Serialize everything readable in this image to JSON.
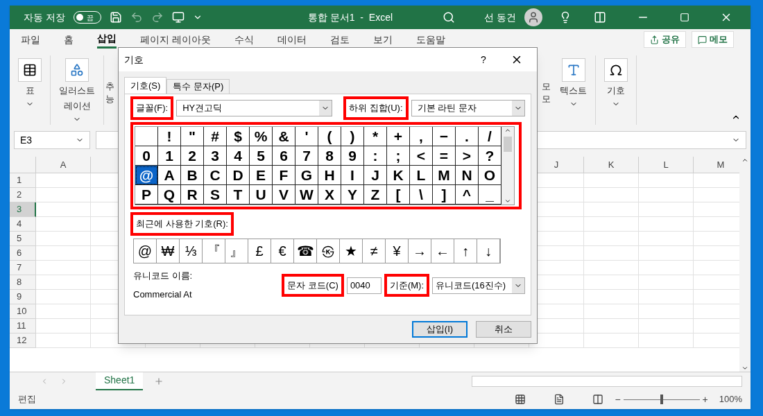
{
  "title_bar": {
    "autosave_label": "자동 저장",
    "autosave": {
      "on": false,
      "text": "끔"
    },
    "title": "통합 문서1  -  Excel",
    "user": "선 동건"
  },
  "ribbon_tabs": [
    {
      "label": "파일",
      "selected": false
    },
    {
      "label": "홈",
      "selected": false
    },
    {
      "label": "삽입",
      "selected": true
    },
    {
      "label": "페이지 레이아웃",
      "selected": false
    },
    {
      "label": "수식",
      "selected": false
    },
    {
      "label": "데이터",
      "selected": false
    },
    {
      "label": "검토",
      "selected": false
    },
    {
      "label": "보기",
      "selected": false
    },
    {
      "label": "도움말",
      "selected": false
    }
  ],
  "ribbon_actions": [
    {
      "kind": "share",
      "label": "공유"
    },
    {
      "kind": "comment",
      "label": "메모"
    }
  ],
  "ribbon_groups_left": [
    {
      "kind": "table",
      "lines": [
        "표"
      ]
    },
    {
      "kind": "shapes",
      "lines": [
        "일러스트",
        "레이션"
      ]
    },
    {
      "kind": "partial",
      "lines": [
        "추",
        "능"
      ]
    }
  ],
  "ribbon_groups_right": [
    {
      "kind": "partial",
      "lines": [
        "모",
        "모"
      ]
    },
    {
      "kind": "text",
      "lines": [
        "텍스트"
      ]
    },
    {
      "kind": "symbol",
      "lines": [
        "기호"
      ]
    }
  ],
  "name_box": "E3",
  "columns": [
    "A",
    "J",
    "K",
    "L",
    "M"
  ],
  "rows": [
    {
      "label": "1",
      "selected": false
    },
    {
      "label": "2",
      "selected": false
    },
    {
      "label": "3",
      "selected": true
    },
    {
      "label": "4",
      "selected": false
    },
    {
      "label": "5",
      "selected": false
    },
    {
      "label": "6",
      "selected": false
    },
    {
      "label": "7",
      "selected": false
    },
    {
      "label": "8",
      "selected": false
    },
    {
      "label": "9",
      "selected": false
    },
    {
      "label": "10",
      "selected": false
    },
    {
      "label": "11",
      "selected": false
    },
    {
      "label": "12",
      "selected": false
    }
  ],
  "sheet_tabs": [
    {
      "label": "Sheet1",
      "selected": true
    }
  ],
  "status_bar": {
    "mode": "편집",
    "zoom": {
      "minus": "−",
      "plus": "+",
      "level": 0.5,
      "reading": "100%"
    }
  },
  "dialog": {
    "title": "기호",
    "help": "?",
    "tabs": [
      {
        "label": "기호(S)",
        "selected": true
      },
      {
        "label": "특수 문자(P)",
        "selected": false
      }
    ],
    "font": {
      "label": "글꼴(F):",
      "highlighted": true,
      "value": "HY견고딕"
    },
    "subset": {
      "label": "하위 집합(U):",
      "highlighted": true,
      "value": "기본 라틴 문자"
    },
    "grid_highlighted": true,
    "grid": [
      [
        {
          "selected": false
        },
        {
          "c": "!",
          "selected": false
        },
        {
          "c": "\"",
          "selected": false
        },
        {
          "c": "#",
          "selected": false
        },
        {
          "c": "$",
          "selected": false
        },
        {
          "c": "%",
          "selected": false
        },
        {
          "c": "&",
          "selected": false
        },
        {
          "c": "'",
          "selected": false
        },
        {
          "c": "(",
          "selected": false
        },
        {
          "c": ")",
          "selected": false
        },
        {
          "c": "*",
          "selected": false
        },
        {
          "c": "+",
          "selected": false
        },
        {
          "c": ",",
          "selected": false
        },
        {
          "c": "−",
          "selected": false
        },
        {
          "c": ".",
          "selected": false
        },
        {
          "c": "/",
          "selected": false
        }
      ],
      [
        {
          "c": "0",
          "selected": false
        },
        {
          "c": "1",
          "selected": false
        },
        {
          "c": "2",
          "selected": false
        },
        {
          "c": "3",
          "selected": false
        },
        {
          "c": "4",
          "selected": false
        },
        {
          "c": "5",
          "selected": false
        },
        {
          "c": "6",
          "selected": false
        },
        {
          "c": "7",
          "selected": false
        },
        {
          "c": "8",
          "selected": false
        },
        {
          "c": "9",
          "selected": false
        },
        {
          "c": ":",
          "selected": false
        },
        {
          "c": ";",
          "selected": false
        },
        {
          "c": "<",
          "selected": false
        },
        {
          "c": "=",
          "selected": false
        },
        {
          "c": ">",
          "selected": false
        },
        {
          "c": "?",
          "selected": false
        }
      ],
      [
        {
          "c": "@",
          "selected": true
        },
        {
          "c": "A",
          "selected": false
        },
        {
          "c": "B",
          "selected": false
        },
        {
          "c": "C",
          "selected": false
        },
        {
          "c": "D",
          "selected": false
        },
        {
          "c": "E",
          "selected": false
        },
        {
          "c": "F",
          "selected": false
        },
        {
          "c": "G",
          "selected": false
        },
        {
          "c": "H",
          "selected": false
        },
        {
          "c": "I",
          "selected": false
        },
        {
          "c": "J",
          "selected": false
        },
        {
          "c": "K",
          "selected": false
        },
        {
          "c": "L",
          "selected": false
        },
        {
          "c": "M",
          "selected": false
        },
        {
          "c": "N",
          "selected": false
        },
        {
          "c": "O",
          "selected": false
        }
      ],
      [
        {
          "c": "P",
          "selected": false
        },
        {
          "c": "Q",
          "selected": false
        },
        {
          "c": "R",
          "selected": false
        },
        {
          "c": "S",
          "selected": false
        },
        {
          "c": "T",
          "selected": false
        },
        {
          "c": "U",
          "selected": false
        },
        {
          "c": "V",
          "selected": false
        },
        {
          "c": "W",
          "selected": false
        },
        {
          "c": "X",
          "selected": false
        },
        {
          "c": "Y",
          "selected": false
        },
        {
          "c": "Z",
          "selected": false
        },
        {
          "c": "[",
          "selected": false
        },
        {
          "c": "\\",
          "selected": false
        },
        {
          "c": "]",
          "selected": false
        },
        {
          "c": "^",
          "selected": false
        },
        {
          "c": "_",
          "selected": false
        }
      ]
    ],
    "recent": {
      "label": "최근에 사용한 기호(R):",
      "highlighted": true,
      "symbols": [
        "@",
        "₩",
        "⅓",
        "『",
        "』",
        "£",
        "€",
        "☎",
        "㉿",
        "★",
        "≠",
        "¥",
        "→",
        "←",
        "↑",
        "↓"
      ]
    },
    "unicode_name": {
      "label": "유니코드 이름:",
      "value": "Commercial At"
    },
    "char_code": {
      "label": "문자 코드(C)",
      "highlighted": true,
      "value": "0040"
    },
    "base": {
      "label": "기준(M):",
      "highlighted": true,
      "value": "유니코드(16진수)"
    },
    "buttons": [
      {
        "label": "삽입(I)",
        "default": true
      },
      {
        "label": "취소",
        "default": false
      }
    ]
  }
}
